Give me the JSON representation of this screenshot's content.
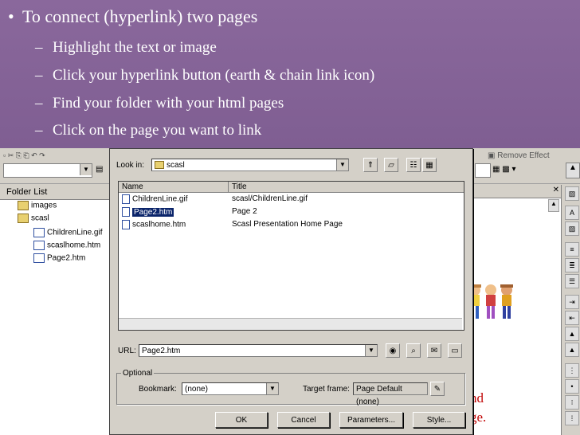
{
  "slide": {
    "bullet": "To connect (hyperlink) two pages",
    "subs": [
      "Highlight the text or image",
      "Click your hyperlink button (earth & chain link icon)",
      "Find your folder with your html pages",
      "Click on the page you want to link"
    ]
  },
  "app": {
    "folder_list_title": "Folder List",
    "tree": [
      "images",
      "scasl",
      "ChildrenLine.gif",
      "scaslhome.htm",
      "Page2.htm"
    ],
    "toolbar_text": "Remove Effect",
    "editor_fragments": [
      "nd",
      "ge."
    ]
  },
  "dialog": {
    "look_in_label": "Look in:",
    "look_in_value": "scasl",
    "columns": [
      "Name",
      "Title"
    ],
    "files": [
      {
        "name": "ChildrenLine.gif",
        "title": "scasl/ChildrenLine.gif",
        "selected": false
      },
      {
        "name": "Page2.htm",
        "title": "Page 2",
        "selected": true
      },
      {
        "name": "scaslhome.htm",
        "title": "Scasl Presentation Home Page",
        "selected": false
      }
    ],
    "url_label": "URL:",
    "url_value": "Page2.htm",
    "optional_label": "Optional",
    "bookmark_label": "Bookmark:",
    "bookmark_value": "(none)",
    "target_label": "Target frame:",
    "target_value": "Page Default (none)",
    "buttons": {
      "ok": "OK",
      "cancel": "Cancel",
      "parameters": "Parameters...",
      "style": "Style..."
    }
  }
}
